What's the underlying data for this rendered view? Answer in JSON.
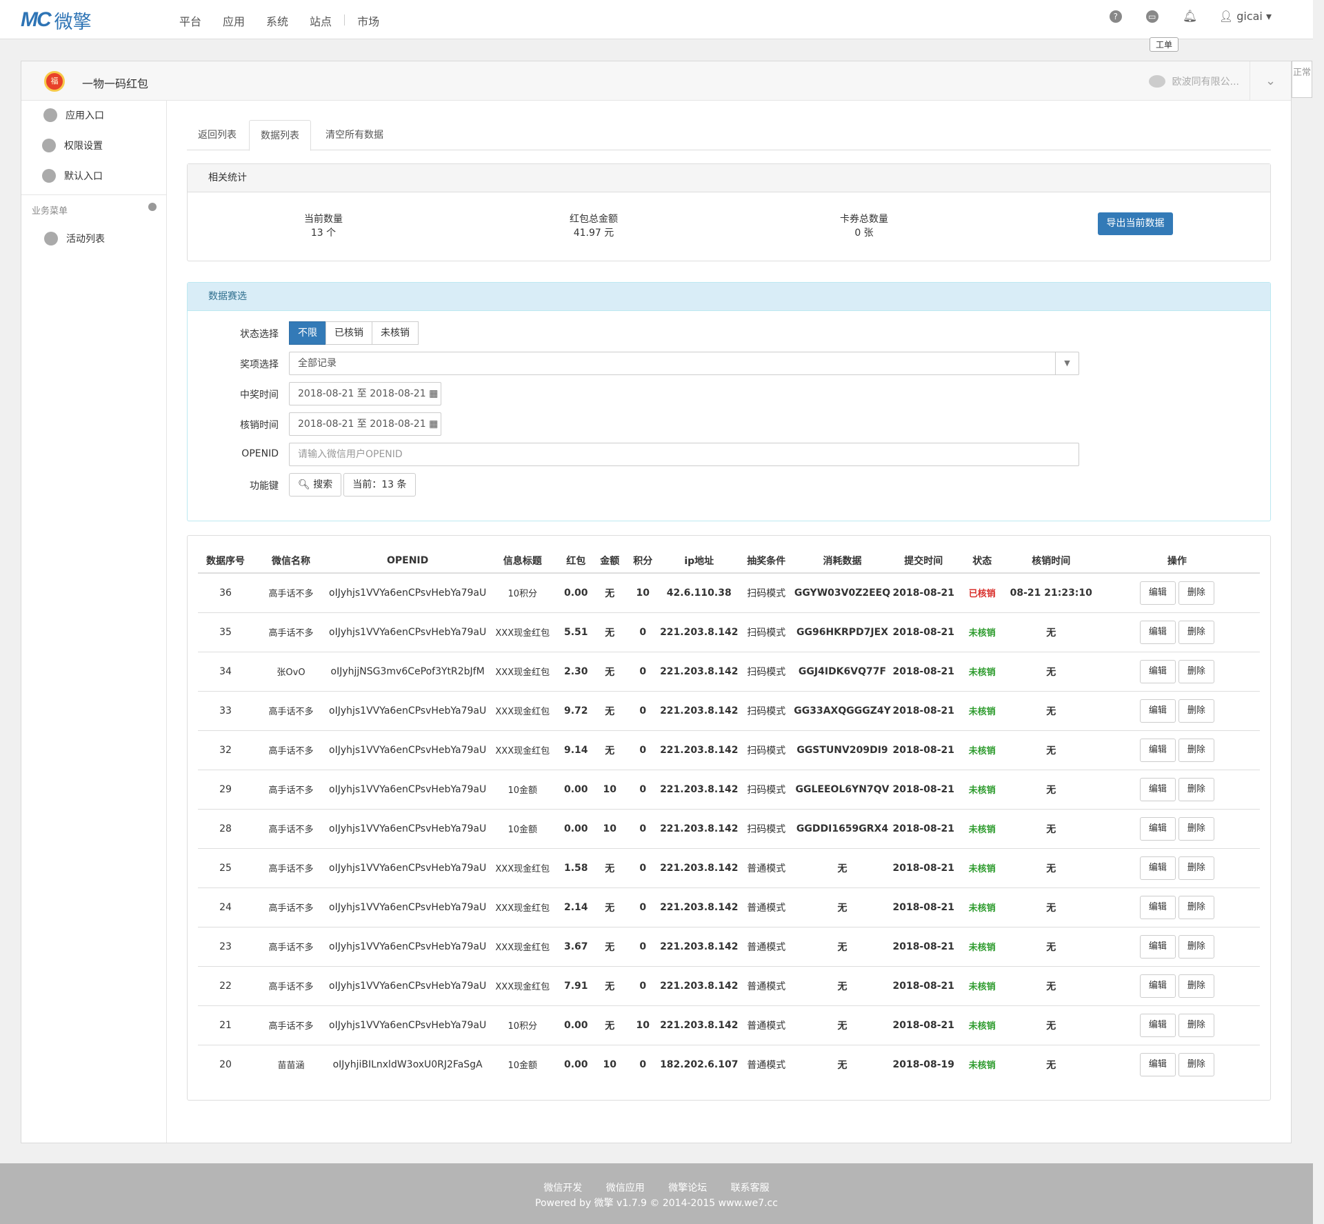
{
  "nav": {
    "logo_mark": "MC",
    "logo_text": "微擎",
    "links": [
      "平台",
      "应用",
      "系统",
      "站点",
      "市场"
    ],
    "user": "gicai",
    "tooltip": "工单"
  },
  "app": {
    "title": "一物一码红包",
    "account": "欧波同有限公...",
    "status_tab": "正常"
  },
  "sidebar": {
    "items": [
      "应用入口",
      "权限设置",
      "默认入口"
    ],
    "section": "业务菜单",
    "section_items": [
      "活动列表"
    ]
  },
  "tabs": [
    "返回列表",
    "数据列表",
    "清空所有数据"
  ],
  "stats": {
    "heading": "相关统计",
    "items": [
      {
        "label": "当前数量",
        "value": "13 个"
      },
      {
        "label": "红包总金额",
        "value": "41.97 元"
      },
      {
        "label": "卡券总数量",
        "value": "0 张"
      }
    ],
    "export_label": "导出当前数据"
  },
  "filter": {
    "heading": "数据赛选",
    "status_label": "状态选择",
    "status_options": [
      "不限",
      "已核销",
      "未核销"
    ],
    "prize_label": "奖项选择",
    "prize_value": "全部记录",
    "win_time_label": "中奖时间",
    "win_time_value": "2018-08-21 至 2018-08-21",
    "verify_time_label": "核销时间",
    "verify_time_value": "2018-08-21 至 2018-08-21",
    "openid_label": "OPENID",
    "openid_placeholder": "请输入微信用户OPENID",
    "func_label": "功能键",
    "search_label": "搜索",
    "count_label": "当前：13 条"
  },
  "table": {
    "headers": [
      "数据序号",
      "微信名称",
      "OPENID",
      "信息标题",
      "红包",
      "金额",
      "积分",
      "ip地址",
      "抽奖条件",
      "消耗数据",
      "提交时间",
      "状态",
      "核销时间",
      "操作"
    ],
    "edit_label": "编辑",
    "delete_label": "删除",
    "rows": [
      [
        "36",
        "高手话不多",
        "oIJyhjs1VVYa6enCPsvHebYa79aU",
        "10积分",
        "0.00",
        "无",
        "10",
        "42.6.110.38",
        "扫码模式",
        "GGYW03V0Z2EEQ",
        "2018-08-21",
        "已核销",
        "08-21 21:23:10"
      ],
      [
        "35",
        "高手话不多",
        "oIJyhjs1VVYa6enCPsvHebYa79aU",
        "XXX现金红包",
        "5.51",
        "无",
        "0",
        "221.203.8.142",
        "扫码模式",
        "GG96HKRPD7JEX",
        "2018-08-21",
        "未核销",
        "无"
      ],
      [
        "34",
        "张OvO",
        "oIJyhjjNSG3mv6CePof3YtR2bJfM",
        "XXX现金红包",
        "2.30",
        "无",
        "0",
        "221.203.8.142",
        "扫码模式",
        "GGJ4IDK6VQ77F",
        "2018-08-21",
        "未核销",
        "无"
      ],
      [
        "33",
        "高手话不多",
        "oIJyhjs1VVYa6enCPsvHebYa79aU",
        "XXX现金红包",
        "9.72",
        "无",
        "0",
        "221.203.8.142",
        "扫码模式",
        "GG33AXQGGGZ4Y",
        "2018-08-21",
        "未核销",
        "无"
      ],
      [
        "32",
        "高手话不多",
        "oIJyhjs1VVYa6enCPsvHebYa79aU",
        "XXX现金红包",
        "9.14",
        "无",
        "0",
        "221.203.8.142",
        "扫码模式",
        "GGSTUNV209DI9",
        "2018-08-21",
        "未核销",
        "无"
      ],
      [
        "29",
        "高手话不多",
        "oIJyhjs1VVYa6enCPsvHebYa79aU",
        "10金额",
        "0.00",
        "10",
        "0",
        "221.203.8.142",
        "扫码模式",
        "GGLEEOL6YN7QV",
        "2018-08-21",
        "未核销",
        "无"
      ],
      [
        "28",
        "高手话不多",
        "oIJyhjs1VVYa6enCPsvHebYa79aU",
        "10金额",
        "0.00",
        "10",
        "0",
        "221.203.8.142",
        "扫码模式",
        "GGDDI1659GRX4",
        "2018-08-21",
        "未核销",
        "无"
      ],
      [
        "25",
        "高手话不多",
        "oIJyhjs1VVYa6enCPsvHebYa79aU",
        "XXX现金红包",
        "1.58",
        "无",
        "0",
        "221.203.8.142",
        "普通模式",
        "无",
        "2018-08-21",
        "未核销",
        "无"
      ],
      [
        "24",
        "高手话不多",
        "oIJyhjs1VVYa6enCPsvHebYa79aU",
        "XXX现金红包",
        "2.14",
        "无",
        "0",
        "221.203.8.142",
        "普通模式",
        "无",
        "2018-08-21",
        "未核销",
        "无"
      ],
      [
        "23",
        "高手话不多",
        "oIJyhjs1VVYa6enCPsvHebYa79aU",
        "XXX现金红包",
        "3.67",
        "无",
        "0",
        "221.203.8.142",
        "普通模式",
        "无",
        "2018-08-21",
        "未核销",
        "无"
      ],
      [
        "22",
        "高手话不多",
        "oIJyhjs1VVYa6enCPsvHebYa79aU",
        "XXX现金红包",
        "7.91",
        "无",
        "0",
        "221.203.8.142",
        "普通模式",
        "无",
        "2018-08-21",
        "未核销",
        "无"
      ],
      [
        "21",
        "高手话不多",
        "oIJyhjs1VVYa6enCPsvHebYa79aU",
        "10积分",
        "0.00",
        "无",
        "10",
        "221.203.8.142",
        "普通模式",
        "无",
        "2018-08-21",
        "未核销",
        "无"
      ],
      [
        "20",
        "苗苗涵",
        "oIJyhjiBILnxldW3oxU0RJ2FaSgA",
        "10金额",
        "0.00",
        "10",
        "0",
        "182.202.6.107",
        "普通模式",
        "无",
        "2018-08-19",
        "未核销",
        "无"
      ]
    ]
  },
  "footer": {
    "links": [
      "微信开发",
      "微信应用",
      "微擎论坛",
      "联系客服"
    ],
    "copyright": "Powered by 微擎 v1.7.9 © 2014-2015 www.we7.cc"
  },
  "colors": {
    "primary": "#337ab7",
    "verified": "#d9302c",
    "unverified": "#2f9c2f"
  }
}
